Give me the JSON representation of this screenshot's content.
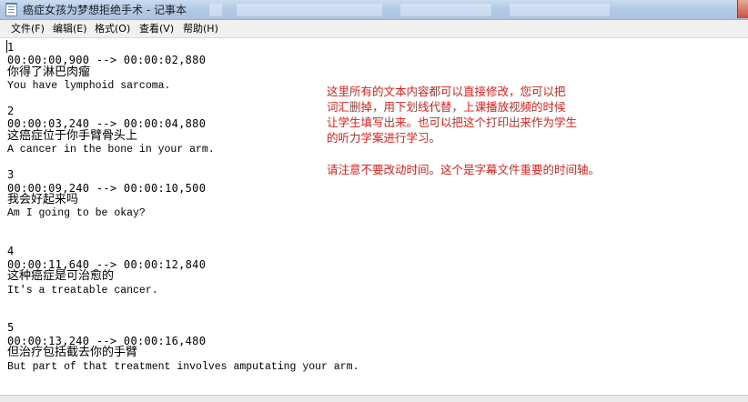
{
  "window": {
    "title": "癌症女孩为梦想拒绝手术 - 记事本"
  },
  "menu": {
    "items": [
      "文件(F)",
      "编辑(E)",
      "格式(O)",
      "查看(V)",
      "帮助(H)"
    ]
  },
  "subtitles": [
    {
      "index": "1",
      "time": "00:00:00,900 --> 00:00:02,880",
      "cn": "你得了淋巴肉瘤",
      "en": "You have lymphoid sarcoma."
    },
    {
      "index": "2",
      "time": "00:00:03,240 --> 00:00:04,880",
      "cn": "这癌症位于你手臂骨头上",
      "en": "A cancer in the bone in your arm."
    },
    {
      "index": "3",
      "time": "00:00:09,240 --> 00:00:10,500",
      "cn": "我会好起来吗",
      "en": "Am I going to be okay?"
    },
    {
      "index": "4",
      "time": "00:00:11,640 --> 00:00:12,840",
      "cn": "这种癌症是可治愈的",
      "en": "It's a treatable cancer."
    },
    {
      "index": "5",
      "time": "00:00:13,240 --> 00:00:16,480",
      "cn": "但治疗包括截去你的手臂",
      "en": "But part of that treatment involves amputating your arm."
    }
  ],
  "annotation": {
    "lines": [
      "这里所有的文本内容都可以直接修改，您可以把",
      "词汇删掉，用下划线代替，上课播放视频的时候",
      "让学生填写出来。也可以把这个打印出来作为学生",
      "的听力学案进行学习。",
      "请注意不要改动时间。这个是字幕文件重要的时间轴。"
    ],
    "color": "#e0201c"
  },
  "colors": {
    "text": "#000000",
    "titlebar": "#b4cbe6"
  }
}
